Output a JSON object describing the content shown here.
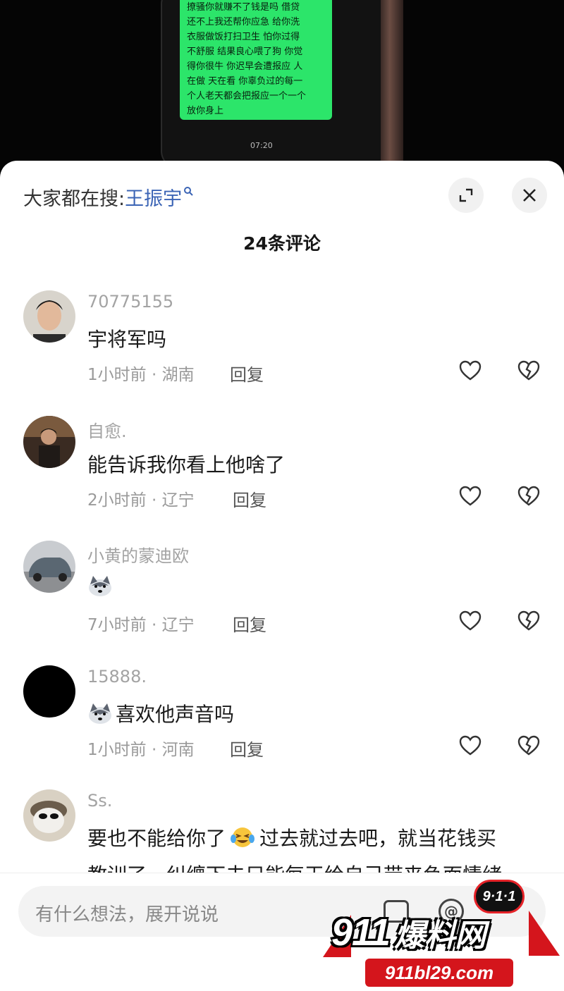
{
  "video": {
    "message_lines": [
      "撩骚你就赚不了钱是吗  借贷",
      "还不上我还帮你应急 给你洗",
      "衣服做饭打扫卫生 怕你过得",
      "不舒服 结果良心喂了狗 你觉",
      "得你很牛 你迟早会遭报应 人",
      "在做 天在看 你辜负过的每一",
      "个人老天都会把报应一个一个",
      "放你身上"
    ],
    "timestamp": "07:20"
  },
  "sheet": {
    "search_prefix": "大家都在搜:",
    "search_keyword": "王振宇",
    "comment_count": "24条评论"
  },
  "comments": [
    {
      "username": "70775155",
      "text": "宇将军吗",
      "meta": "1小时前 · 湖南",
      "reply": "回复"
    },
    {
      "username": "自愈.",
      "text": "能告诉我你看上他啥了",
      "meta": "2小时前 · 辽宁",
      "reply": "回复"
    },
    {
      "username": "小黄的蒙迪欧",
      "text": "",
      "meta": "7小时前 · 辽宁",
      "reply": "回复"
    },
    {
      "username": "15888.",
      "text": "喜欢他声音吗",
      "meta": "1小时前 · 河南",
      "reply": "回复"
    },
    {
      "username": "Ss.",
      "text": "要也不能给你了",
      "text2": "过去就过去吧，就当花钱买",
      "text3": "教训了，纠缠下去只能每天给自己带来负面情绪"
    }
  ],
  "input": {
    "placeholder": "有什么想法，展开说说"
  },
  "watermark": {
    "badge": "9·1·1",
    "brand_num": "911",
    "brand_cn": "爆料网",
    "url": "911bl29.com"
  },
  "colors": {
    "accent_link": "#3b64b5",
    "bubble_green": "#2ce56a",
    "watermark_red": "#d4151c"
  }
}
